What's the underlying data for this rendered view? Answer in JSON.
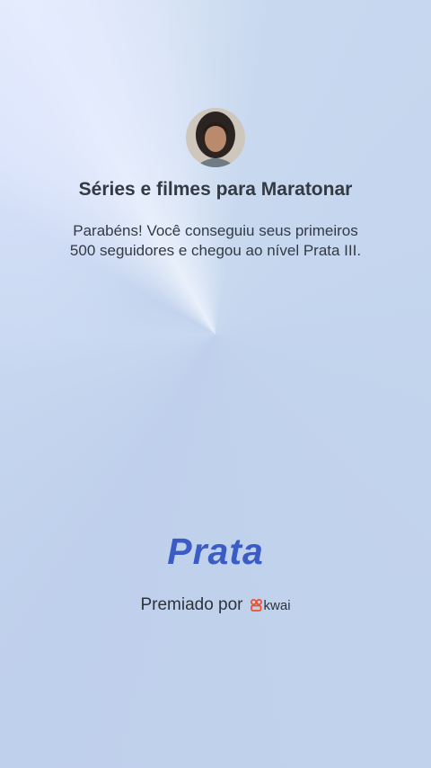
{
  "title": "Séries e filmes para Maratonar",
  "message_line1": "Parabéns! Você conseguiu seus primeiros",
  "message_line2": "500 seguidores e chegou ao nível Prata III.",
  "level_name": "Prata",
  "awarded_by": "Premiado por",
  "brand_name": "kwai",
  "colors": {
    "level_text": "#3a5cc4",
    "brand_icon": "#ef4f2e",
    "text": "#333a44"
  },
  "icons": {
    "avatar": "avatar",
    "brand": "kwai-logo-icon"
  }
}
